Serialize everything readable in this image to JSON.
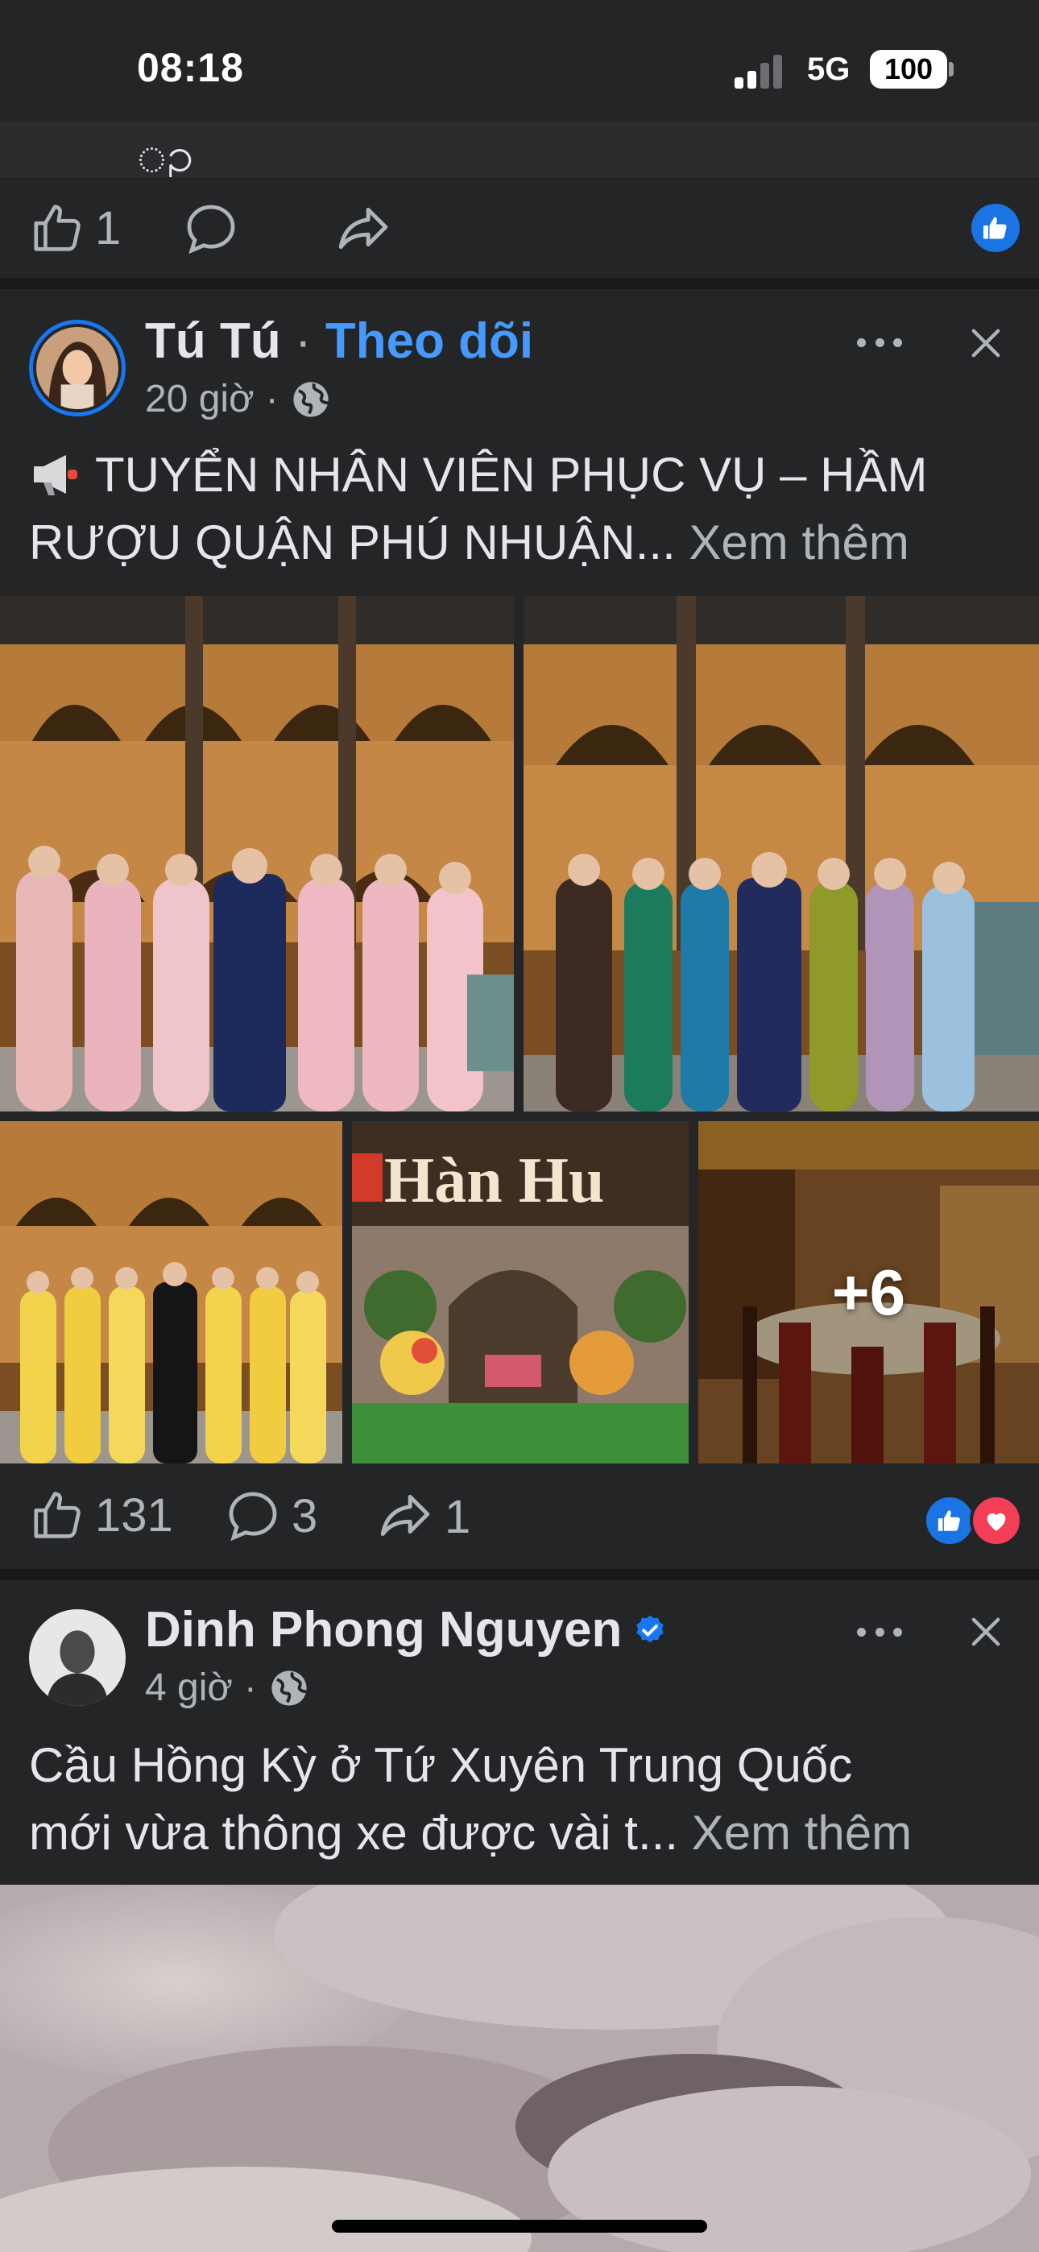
{
  "status_bar": {
    "time": "08:18",
    "network": "5G",
    "battery": "100"
  },
  "prev_post": {
    "like_count": "1"
  },
  "post1": {
    "author": "Tú Tú",
    "dot": "·",
    "follow_label": "Theo dõi",
    "time": "20 giờ",
    "text_line1": "TUYỂN NHÂN VIÊN PHỤC VỤ – HẦM",
    "text_line2": "RƯỢU QUẬN PHÚ NHUẬN...",
    "see_more": "Xem thêm",
    "extra_photos": "+6",
    "sign_text": "Hàn Hu",
    "like_count": "131",
    "comment_count": "3",
    "share_count": "1"
  },
  "post2": {
    "author": "Dinh Phong Nguyen",
    "time": "4 giờ",
    "text_line1": "Cầu Hồng Kỳ ở Tứ Xuyên Trung Quốc",
    "text_line2": "mới vừa thông xe được vài t...",
    "see_more": "Xem thêm"
  },
  "colors": {
    "background": "#242526",
    "separator": "#18191a",
    "accent_blue": "#4599ff",
    "like_blue": "#1b74e4",
    "love_red": "#f33e58"
  },
  "icons": [
    "megaphone-icon",
    "globe-icon",
    "like-icon",
    "comment-icon",
    "share-icon",
    "more-icon",
    "close-icon",
    "verified-badge-icon",
    "signal-icon",
    "battery-icon"
  ]
}
